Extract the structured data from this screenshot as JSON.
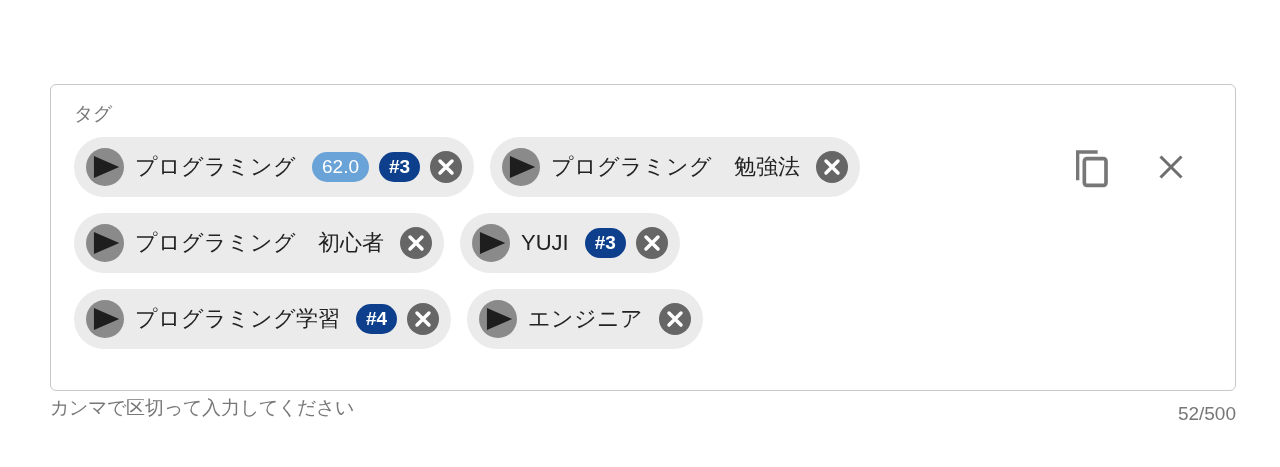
{
  "field": {
    "label": "タグ",
    "tags": [
      {
        "text": "プログラミング",
        "badges": [
          {
            "kind": "score",
            "text": "62.0"
          },
          {
            "kind": "rank",
            "text": "#3"
          }
        ]
      },
      {
        "text": "プログラミング　勉強法"
      },
      {
        "text": "プログラミング　初心者"
      },
      {
        "text": "YUJI",
        "badges": [
          {
            "kind": "rank",
            "text": "#3"
          }
        ]
      },
      {
        "text": "プログラミング学習",
        "badges": [
          {
            "kind": "rank",
            "text": "#4"
          }
        ]
      },
      {
        "text": "エンジニア"
      }
    ],
    "helper": "カンマで区切って入力してください",
    "counter": "52/500"
  }
}
